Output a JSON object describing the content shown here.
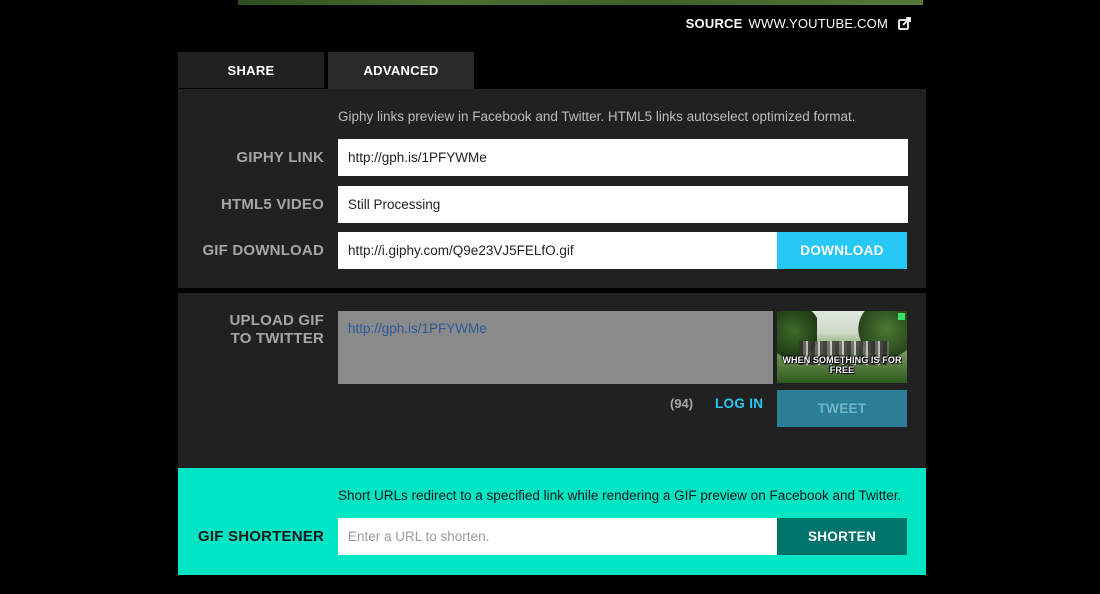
{
  "source": {
    "label": "SOURCE",
    "value": "WWW.YOUTUBE.COM",
    "icon": "external-share-icon"
  },
  "tabs": [
    {
      "label": "SHARE"
    },
    {
      "label": "ADVANCED"
    }
  ],
  "links": {
    "info": "Giphy links preview in Facebook and Twitter. HTML5 links autoselect optimized format.",
    "giphy_link": {
      "label": "GIPHY LINK",
      "value": "http://gph.is/1PFYWMe"
    },
    "html5_video": {
      "label": "HTML5 VIDEO",
      "value": "Still Processing"
    },
    "gif_download": {
      "label": "GIF DOWNLOAD",
      "value": "http://i.giphy.com/Q9e23VJ5FELfO.gif",
      "button": "DOWNLOAD"
    }
  },
  "upload": {
    "label_line1": "UPLOAD GIF",
    "label_line2": "TO TWITTER",
    "tweet_text": "http://gph.is/1PFYWMe",
    "thumbnail_caption": "WHEN SOMETHING IS FOR FREE",
    "char_count": "(94)",
    "login": "LOG IN",
    "tweet_button": "TWEET"
  },
  "shortener": {
    "info": "Short URLs redirect to a specified link while rendering a GIF preview on Facebook and Twitter.",
    "label": "GIF SHORTENER",
    "placeholder": "Enter a URL to shorten.",
    "button": "SHORTEN"
  },
  "colors": {
    "accent_blue": "#26c8f3",
    "teal": "#00e5c4",
    "dark_teal": "#00746b",
    "panel": "#212121",
    "tweet_button": "#2a7f97"
  }
}
